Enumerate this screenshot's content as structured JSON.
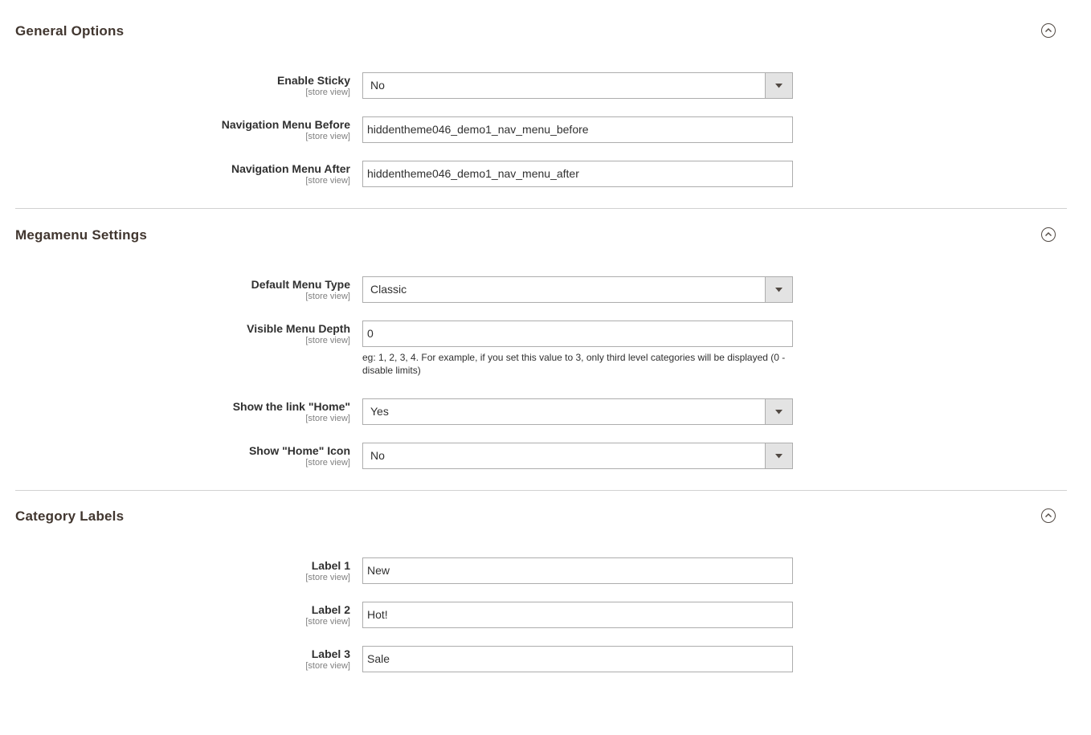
{
  "sections": [
    {
      "title": "General Options",
      "fields": [
        {
          "label": "Enable Sticky",
          "scope": "[store view]",
          "type": "select",
          "value": "No"
        },
        {
          "label": "Navigation Menu Before",
          "scope": "[store view]",
          "type": "text",
          "value": "hiddentheme046_demo1_nav_menu_before"
        },
        {
          "label": "Navigation Menu After",
          "scope": "[store view]",
          "type": "text",
          "value": "hiddentheme046_demo1_nav_menu_after"
        }
      ]
    },
    {
      "title": "Megamenu Settings",
      "fields": [
        {
          "label": "Default Menu Type",
          "scope": "[store view]",
          "type": "select",
          "value": "Classic"
        },
        {
          "label": "Visible Menu Depth",
          "scope": "[store view]",
          "type": "text",
          "value": "0",
          "note": "eg: 1, 2, 3, 4. For example, if you set this value to 3, only third level categories will be displayed (0 - disable limits)"
        },
        {
          "label": "Show the link \"Home\"",
          "scope": "[store view]",
          "type": "select",
          "value": "Yes"
        },
        {
          "label": "Show \"Home\" Icon",
          "scope": "[store view]",
          "type": "select",
          "value": "No"
        }
      ]
    },
    {
      "title": "Category Labels",
      "fields": [
        {
          "label": "Label 1",
          "scope": "[store view]",
          "type": "text",
          "value": "New"
        },
        {
          "label": "Label 2",
          "scope": "[store view]",
          "type": "text",
          "value": "Hot!"
        },
        {
          "label": "Label 3",
          "scope": "[store view]",
          "type": "text",
          "value": "Sale"
        }
      ]
    }
  ],
  "icons": {
    "collapse": "chevron-up-circle-icon",
    "select_arrow": "caret-down-icon"
  },
  "colors": {
    "title": "#41362f",
    "border": "#adadad",
    "select_arrow_bg": "#e3e3e3",
    "divider": "#d1d1d1",
    "scope_text": "#808080"
  }
}
